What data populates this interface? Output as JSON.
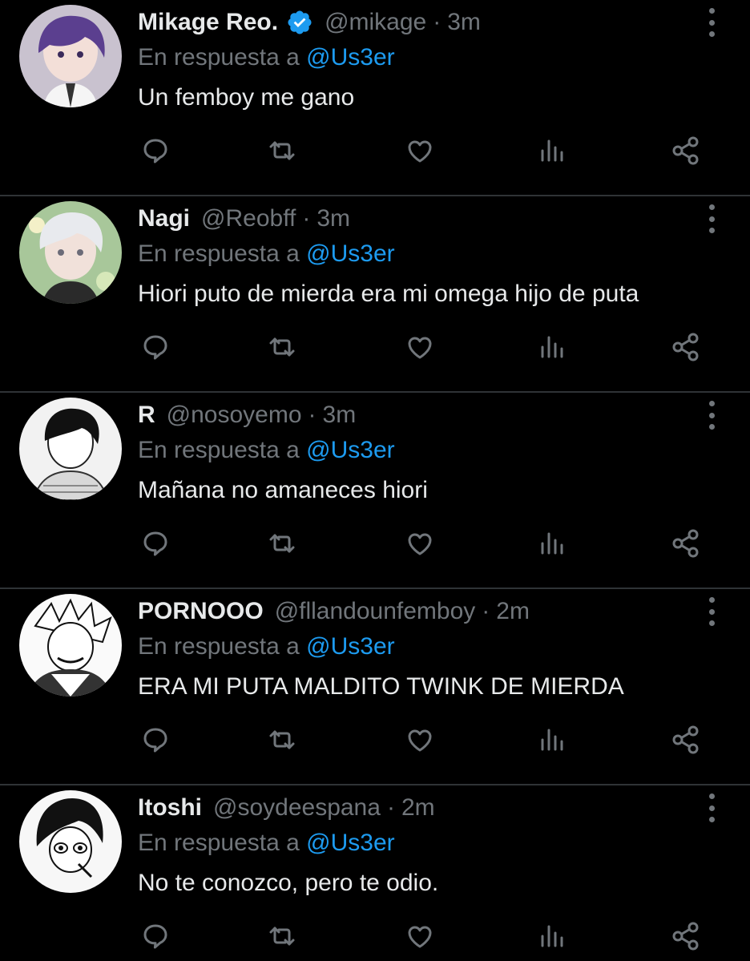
{
  "reply_prefix": "En respuesta a",
  "colors": {
    "background": "#000000",
    "text": "#e7e9ea",
    "muted": "#71767b",
    "link": "#1d9bf0",
    "divider": "#2f3336"
  },
  "icons": [
    "reply-icon",
    "retweet-icon",
    "like-icon",
    "views-icon",
    "share-icon",
    "more-icon",
    "verified-badge-icon"
  ],
  "tweets": [
    {
      "name": "Mikage Reo.",
      "verified": true,
      "handle": "@mikage",
      "time": "3m",
      "mention": "@Us3er",
      "text": "Un femboy me gano"
    },
    {
      "name": "Nagi",
      "verified": false,
      "handle": "@Reobff",
      "time": "3m",
      "mention": "@Us3er",
      "text": "Hiori puto de mierda era mi omega hijo de puta"
    },
    {
      "name": "R",
      "verified": false,
      "handle": "@nosoyemo",
      "time": "3m",
      "mention": "@Us3er",
      "text": "Mañana no amaneces hiori"
    },
    {
      "name": "PORNOOO",
      "verified": false,
      "handle": "@fllandounfemboy",
      "time": "2m",
      "mention": "@Us3er",
      "text": "ERA MI PUTA MALDITO TWINK DE MIERDA"
    },
    {
      "name": "Itoshi",
      "verified": false,
      "handle": "@soydeespana",
      "time": "2m",
      "mention": "@Us3er",
      "text": "No te conozco, pero te odio."
    }
  ]
}
